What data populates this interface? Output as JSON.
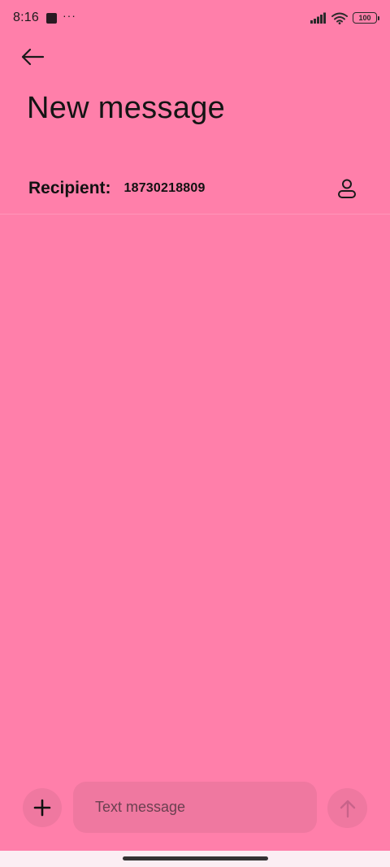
{
  "status_bar": {
    "time": "8:16",
    "more_indicator": "···",
    "battery_level": "100",
    "icons": [
      "notification-square-icon",
      "signal-icon",
      "wifi-icon",
      "battery-icon"
    ]
  },
  "header": {
    "back_icon": "arrow-left-icon",
    "title": "New message"
  },
  "recipient": {
    "label": "Recipient:",
    "value": "18730218809",
    "contact_icon": "contact-person-icon"
  },
  "composer": {
    "attach_icon": "plus-icon",
    "placeholder": "Text message",
    "send_icon": "arrow-up-icon"
  },
  "colors": {
    "background": "#ff7faa",
    "composer_surface": "#ef78a0",
    "nav_bar": "#fbeef3"
  }
}
